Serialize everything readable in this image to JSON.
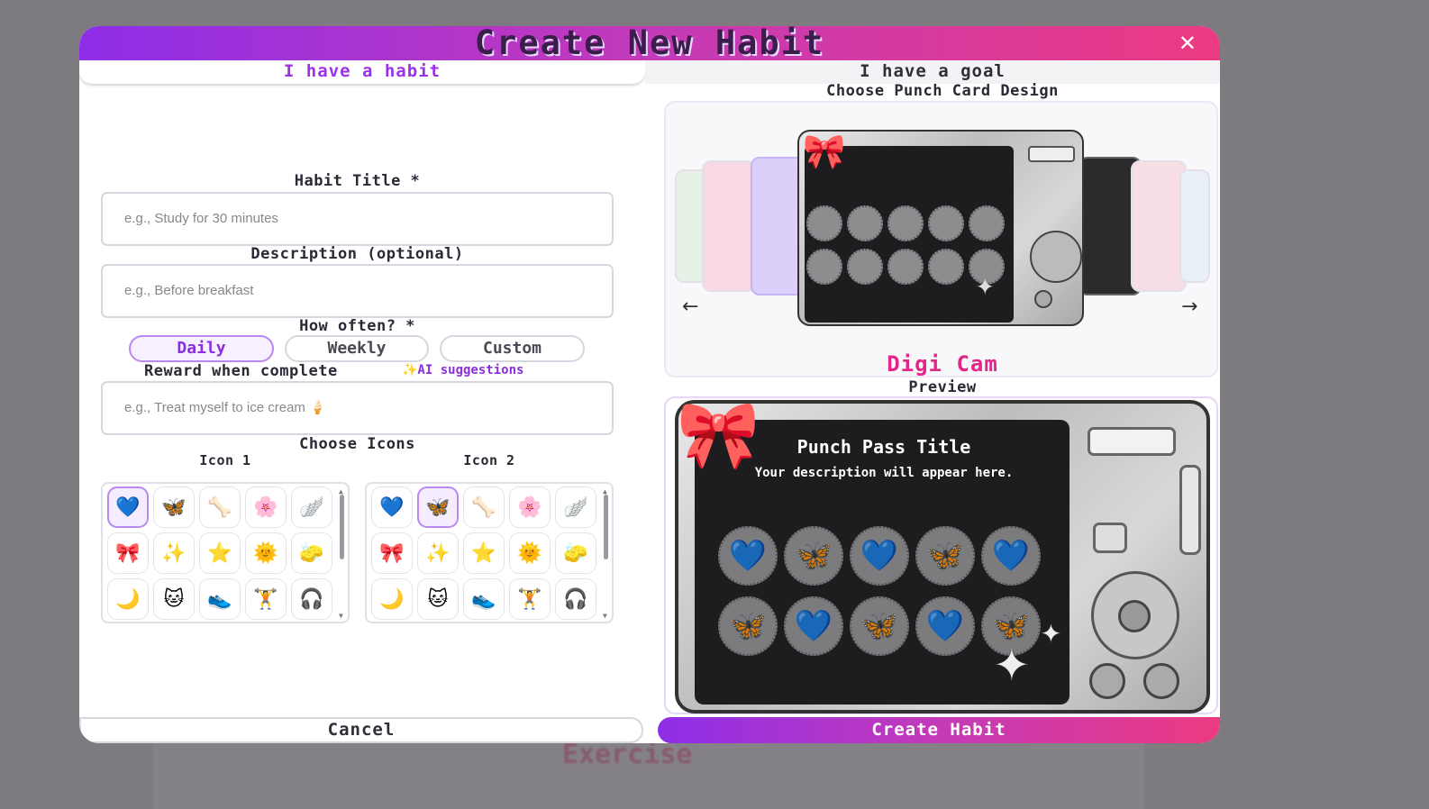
{
  "background": {
    "title": "Exercise"
  },
  "modal": {
    "title": "Create New Habit",
    "close_glyph": "✕",
    "tabs": {
      "habit": "I have a habit",
      "goal": "I have a goal"
    }
  },
  "form": {
    "title_label": "Habit Title *",
    "title_placeholder": "e.g., Study for 30 minutes",
    "desc_label": "Description (optional)",
    "desc_placeholder": "e.g., Before breakfast",
    "freq_label": "How often? *",
    "freq_options": [
      "Daily",
      "Weekly",
      "Custom"
    ],
    "freq_selected": "Daily",
    "reward_label": "Reward when complete",
    "ai_suggestions": "✨AI suggestions",
    "reward_placeholder": "e.g., Treat myself to ice cream 🍦",
    "icons_label": "Choose Icons",
    "icon1_label": "Icon 1",
    "icon2_label": "Icon 2",
    "icon_set": [
      "💙",
      "🦋",
      "🦴",
      "🌸",
      "🪽",
      "🎀",
      "✨",
      "⭐",
      "🌞",
      "🧽",
      "🌙",
      "🐱",
      "👟",
      "🏋",
      "🎧"
    ],
    "icon1_selected": 0,
    "icon2_selected": 1
  },
  "design": {
    "label": "Choose Punch Card Design",
    "name": "Digi Cam",
    "prev_arrow": "←",
    "next_arrow": "→"
  },
  "preview": {
    "label": "Preview",
    "card_title": "Punch Pass Title",
    "card_desc": "Your description will appear here.",
    "dot_icons": [
      "💙",
      "🦋",
      "💙",
      "🦋",
      "💙",
      "🦋",
      "💙",
      "🦋",
      "💙",
      "🦋"
    ]
  },
  "actions": {
    "cancel": "Cancel",
    "create": "Create Habit"
  },
  "colors": {
    "accent_start": "#8e2ee8",
    "accent_end": "#ec3a82",
    "design_name": "#e2268a"
  }
}
